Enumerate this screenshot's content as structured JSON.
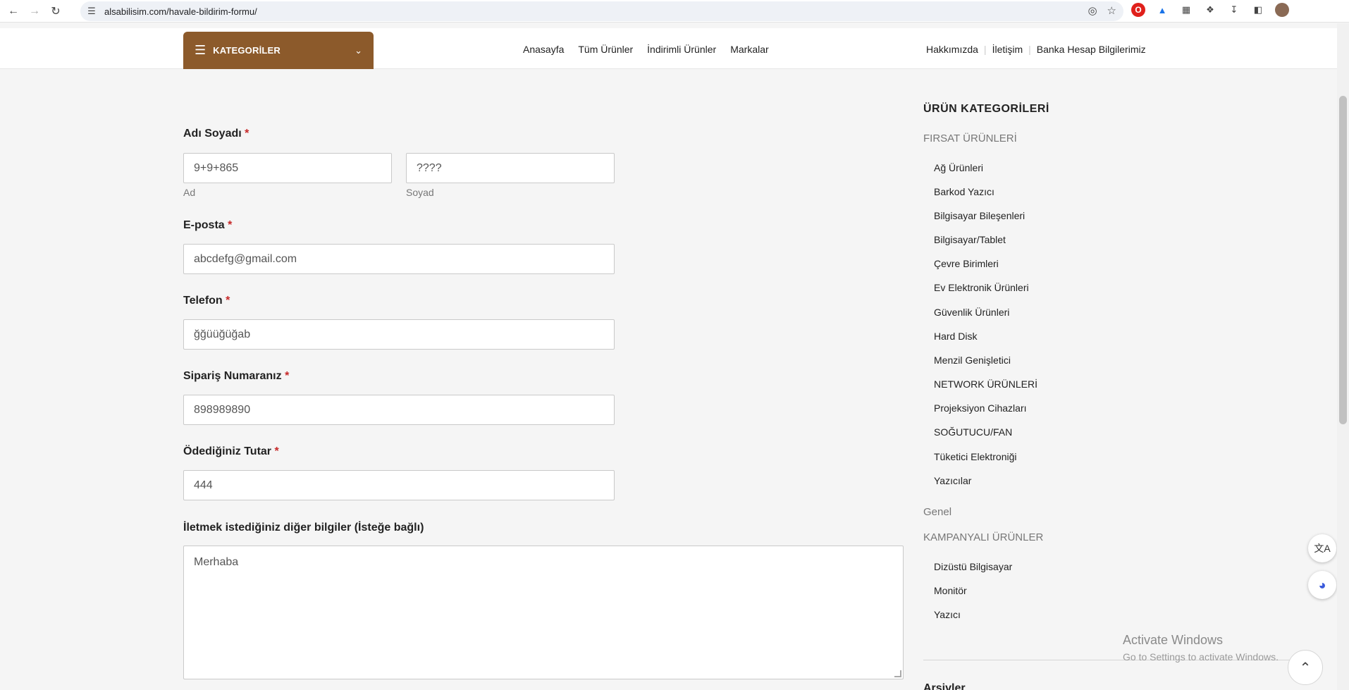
{
  "browser": {
    "url": "alsabilisim.com/havale-bildirim-formu/"
  },
  "header": {
    "categories_label": "KATEGORİLER",
    "main_nav": [
      "Anasayfa",
      "Tüm Ürünler",
      "İndirimli Ürünler",
      "Markalar"
    ],
    "util_nav": [
      "Hakkımızda",
      "İletişim",
      "Banka Hesap Bilgilerimiz"
    ]
  },
  "form": {
    "name_label": "Adı Soyadı",
    "first_name_value": "9+9+865",
    "first_name_sub": "Ad",
    "last_name_value": "????",
    "last_name_sub": "Soyad",
    "email_label": "E-posta",
    "email_value": "abcdefg@gmail.com",
    "phone_label": "Telefon",
    "phone_value": "ğğüüğüğab",
    "order_label": "Sipariş Numaranız",
    "order_value": "898989890",
    "amount_label": "Ödediğiniz Tutar",
    "amount_value": "444",
    "notes_label": "İletmek istediğiniz diğer bilgiler (İsteğe bağlı)",
    "notes_value": "Merhaba",
    "required_mark": "*"
  },
  "sidebar": {
    "title": "ÜRÜN KATEGORİLERİ",
    "group1": "FIRSAT ÜRÜNLERİ",
    "group1_items": [
      "Ağ Ürünleri",
      "Barkod Yazıcı",
      "Bilgisayar Bileşenleri",
      "Bilgisayar/Tablet",
      "Çevre Birimleri",
      "Ev Elektronik Ürünleri",
      "Güvenlik Ürünleri",
      "Hard Disk",
      "Menzil Genişletici",
      "NETWORK ÜRÜNLERİ",
      "Projeksiyon Cihazları",
      "SOĞUTUCU/FAN",
      "Tüketici Elektroniği",
      "Yazıcılar"
    ],
    "group2": "Genel",
    "group3": "KAMPANYALI ÜRÜNLER",
    "group3_items": [
      "Dizüstü Bilgisayar",
      "Monitör",
      "Yazıcı"
    ],
    "next_title": "Arşivler"
  },
  "watermark": {
    "title": "Activate Windows",
    "subtitle": "Go to Settings to activate Windows."
  },
  "icons": {
    "back": "arrow-left-icon",
    "forward": "arrow-right-icon",
    "reload": "reload-icon",
    "translate": "translate-icon",
    "assistant": "assistant-icon",
    "scroll_top": "chevron-up-icon"
  },
  "colors": {
    "category_button": "#8c5a2b",
    "required": "#c62828",
    "page_bg": "#f5f5f5"
  }
}
